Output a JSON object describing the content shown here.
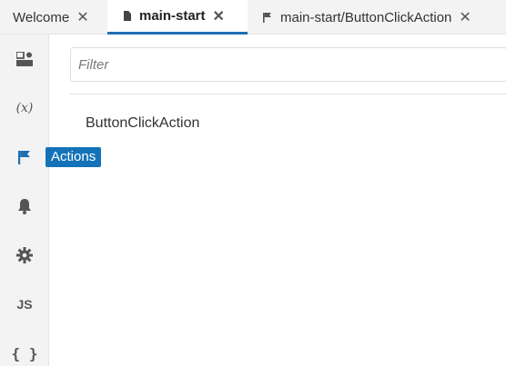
{
  "tabs": [
    {
      "label": "Welcome",
      "close": "✕"
    },
    {
      "label": "main-start",
      "close": "✕",
      "active": true
    },
    {
      "label": "main-start/ButtonClickAction",
      "close": "✕"
    }
  ],
  "sidebar": {
    "items": [
      {
        "name": "dashboard-icon"
      },
      {
        "name": "variables-icon",
        "glyph": "(x)"
      },
      {
        "name": "actions-flag-icon"
      },
      {
        "name": "bell-icon"
      },
      {
        "name": "gear-icon"
      },
      {
        "name": "javascript-icon",
        "glyph": "JS"
      },
      {
        "name": "json-icon",
        "glyph": "{ }"
      }
    ]
  },
  "tooltip": {
    "label": "Actions"
  },
  "filter": {
    "placeholder": "Filter",
    "value": ""
  },
  "list": {
    "items": [
      "ButtonClickAction"
    ]
  },
  "colors": {
    "accent": "#1f6fb3",
    "tooltip_bg": "#1473b8"
  }
}
